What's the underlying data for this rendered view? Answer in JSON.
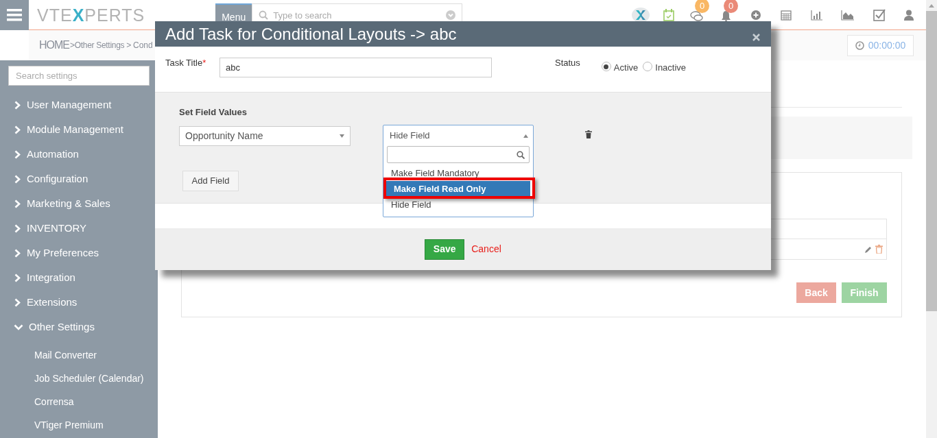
{
  "header": {
    "logo": [
      "VTE",
      "X",
      "PERTS"
    ],
    "menu_button": "Menu",
    "search_placeholder": "Type to search",
    "chat_badge": "0",
    "notification_badge": "0"
  },
  "breadcrumb": {
    "home": "HOME",
    "items": [
      ">Other Settings >",
      "Cond"
    ]
  },
  "timer": "00:00:00",
  "sidebar": {
    "search_placeholder": "Search settings",
    "items": [
      {
        "label": "User Management",
        "expanded": false
      },
      {
        "label": "Module Management",
        "expanded": false
      },
      {
        "label": "Automation",
        "expanded": false
      },
      {
        "label": "Configuration",
        "expanded": false
      },
      {
        "label": "Marketing & Sales",
        "expanded": false
      },
      {
        "label": "INVENTORY",
        "expanded": false
      },
      {
        "label": "My Preferences",
        "expanded": false
      },
      {
        "label": "Integration",
        "expanded": false
      },
      {
        "label": "Extensions",
        "expanded": false
      },
      {
        "label": "Other Settings",
        "expanded": true,
        "children": [
          {
            "label": "Mail Converter"
          },
          {
            "label": "Job Scheduler (Calendar)"
          },
          {
            "label": "Corrensa"
          },
          {
            "label": "VTiger Premium"
          }
        ]
      }
    ]
  },
  "page_buttons": {
    "back": "Back",
    "finish": "Finish"
  },
  "modal": {
    "title": "Add Task for Conditional Layouts -> abc",
    "task_title": {
      "label": "Task Title",
      "required": "*",
      "value": "abc"
    },
    "status": {
      "label": "Status",
      "options": [
        {
          "label": "Active",
          "selected": true
        },
        {
          "label": "Inactive",
          "selected": false
        }
      ]
    },
    "section_title": "Set Field Values",
    "field_select": "Opportunity Name",
    "action_select": {
      "value": "Hide Field",
      "expanded": true,
      "options": [
        {
          "label": "Make Field Mandatory",
          "highlighted": false
        },
        {
          "label": "Make Field Read Only",
          "highlighted": true
        },
        {
          "label": "Hide Field",
          "highlighted": false
        }
      ]
    },
    "add_field": "Add Field",
    "save": "Save",
    "cancel": "Cancel"
  }
}
